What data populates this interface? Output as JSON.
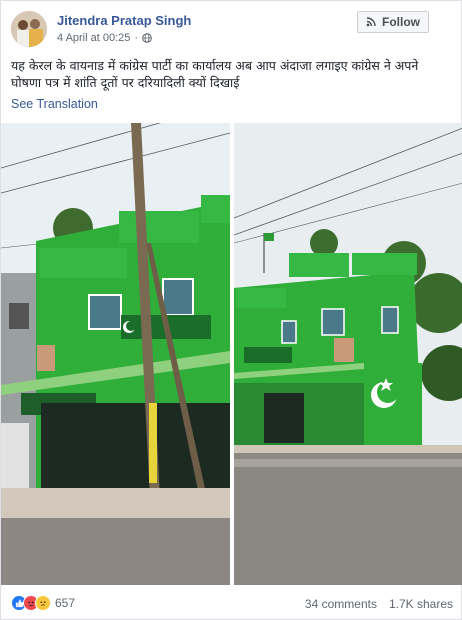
{
  "post": {
    "author": "Jitendra Pratap Singh",
    "timestamp": "4 April at 00:25",
    "privacy_icon": "globe-icon",
    "follow_label": "Follow",
    "text": "यह केरल के वायनाड में कांग्रेस पार्टी का कार्यालय अब आप अंदाजा लगाइए कांग्रेस ने अपने घोषणा पत्र में शांति दूतों पर दरियादिली क्यों दिखाई",
    "see_translation": "See Translation"
  },
  "footer": {
    "reactions_count": "657",
    "comments": "34 comments",
    "shares": "1.7K shares"
  },
  "colors": {
    "link": "#385898",
    "building_green": "#2fae3a",
    "sky": "#e8eef0"
  }
}
